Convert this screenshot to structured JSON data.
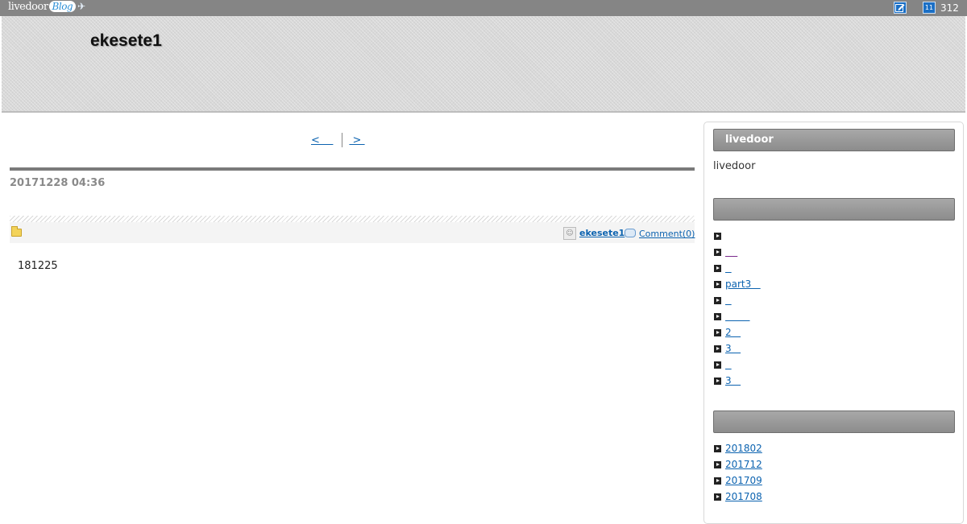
{
  "topbar": {
    "logo_text": "livedoor",
    "logo_badge": "Blog",
    "edit_icon": "edit-icon",
    "calendar_icon": "calendar-icon",
    "calendar_day": "11",
    "count": "312"
  },
  "header": {
    "blog_title": "ekesete1"
  },
  "pager": {
    "prev_label": "<    ",
    "next_label": " > "
  },
  "post": {
    "date": "20171228 04:36",
    "author": "ekesete1",
    "comment_label": "Comment(0)",
    "body": "181225"
  },
  "sidebar": {
    "section1": {
      "title": "livedoor",
      "text": "livedoor"
    },
    "section2": {
      "title": "",
      "items": [
        {
          "label": ""
        },
        {
          "label": "    ",
          "visited": true
        },
        {
          "label": "  "
        },
        {
          "label": "part3   "
        },
        {
          "label": "  "
        },
        {
          "label": "        "
        },
        {
          "label": "2   "
        },
        {
          "label": "3   "
        },
        {
          "label": "  "
        },
        {
          "label": "3   "
        }
      ]
    },
    "section3": {
      "title": "",
      "items": [
        {
          "label": "201802"
        },
        {
          "label": "201712"
        },
        {
          "label": "201709"
        },
        {
          "label": "201708"
        }
      ]
    }
  }
}
